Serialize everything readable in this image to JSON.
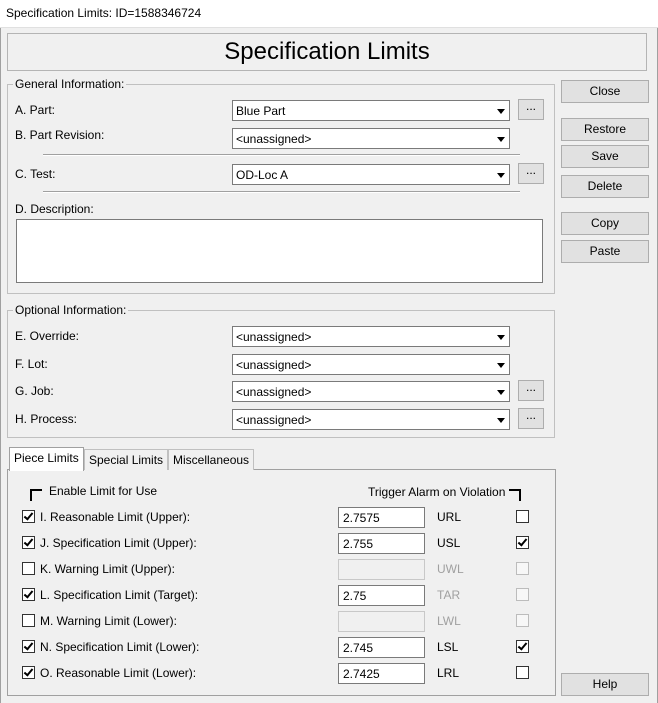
{
  "window": {
    "title": "Specification Limits: ID=1588346724"
  },
  "header": {
    "title": "Specification Limits"
  },
  "general": {
    "legend": "General Information:",
    "part": {
      "label": "A. Part:",
      "value": "Blue Part",
      "ellipsis": "..."
    },
    "revision": {
      "label": "B. Part Revision:",
      "value": "<unassigned>"
    },
    "test": {
      "label": "C. Test:",
      "value": "OD-Loc A",
      "ellipsis": "..."
    },
    "description": {
      "label": "D. Description:",
      "value": ""
    }
  },
  "optional": {
    "legend": "Optional Information:",
    "override": {
      "label": "E. Override:",
      "value": "<unassigned>"
    },
    "lot": {
      "label": "F. Lot:",
      "value": "<unassigned>"
    },
    "job": {
      "label": "G. Job:",
      "value": "<unassigned>",
      "ellipsis": "..."
    },
    "process": {
      "label": "H. Process:",
      "value": "<unassigned>",
      "ellipsis": "..."
    }
  },
  "buttons": {
    "close": "Close",
    "restore": "Restore",
    "save": "Save",
    "delete": "Delete",
    "copy": "Copy",
    "paste": "Paste",
    "help": "Help"
  },
  "tabs": [
    {
      "label": "Piece Limits",
      "active": true
    },
    {
      "label": "Special Limits",
      "active": false
    },
    {
      "label": "Miscellaneous",
      "active": false
    }
  ],
  "limits": {
    "enable_header": "Enable Limit for Use",
    "alarm_header": "Trigger Alarm on Violation",
    "rows": [
      {
        "label": "I. Reasonable Limit (Upper):",
        "enabled": true,
        "value": "2.7575",
        "code": "URL",
        "alarm": false,
        "active": true
      },
      {
        "label": "J. Specification Limit (Upper):",
        "enabled": true,
        "value": "2.755",
        "code": "USL",
        "alarm": true,
        "active": true
      },
      {
        "label": "K. Warning Limit (Upper):",
        "enabled": false,
        "value": "",
        "code": "UWL",
        "alarm": false,
        "active": false
      },
      {
        "label": "L. Specification Limit (Target):",
        "enabled": true,
        "value": "2.75",
        "code": "TAR",
        "alarm": false,
        "active": false
      },
      {
        "label": "M. Warning Limit (Lower):",
        "enabled": false,
        "value": "",
        "code": "LWL",
        "alarm": false,
        "active": false
      },
      {
        "label": "N. Specification Limit (Lower):",
        "enabled": true,
        "value": "2.745",
        "code": "LSL",
        "alarm": true,
        "active": true
      },
      {
        "label": "O. Reasonable Limit (Lower):",
        "enabled": true,
        "value": "2.7425",
        "code": "LRL",
        "alarm": false,
        "active": true
      }
    ]
  }
}
